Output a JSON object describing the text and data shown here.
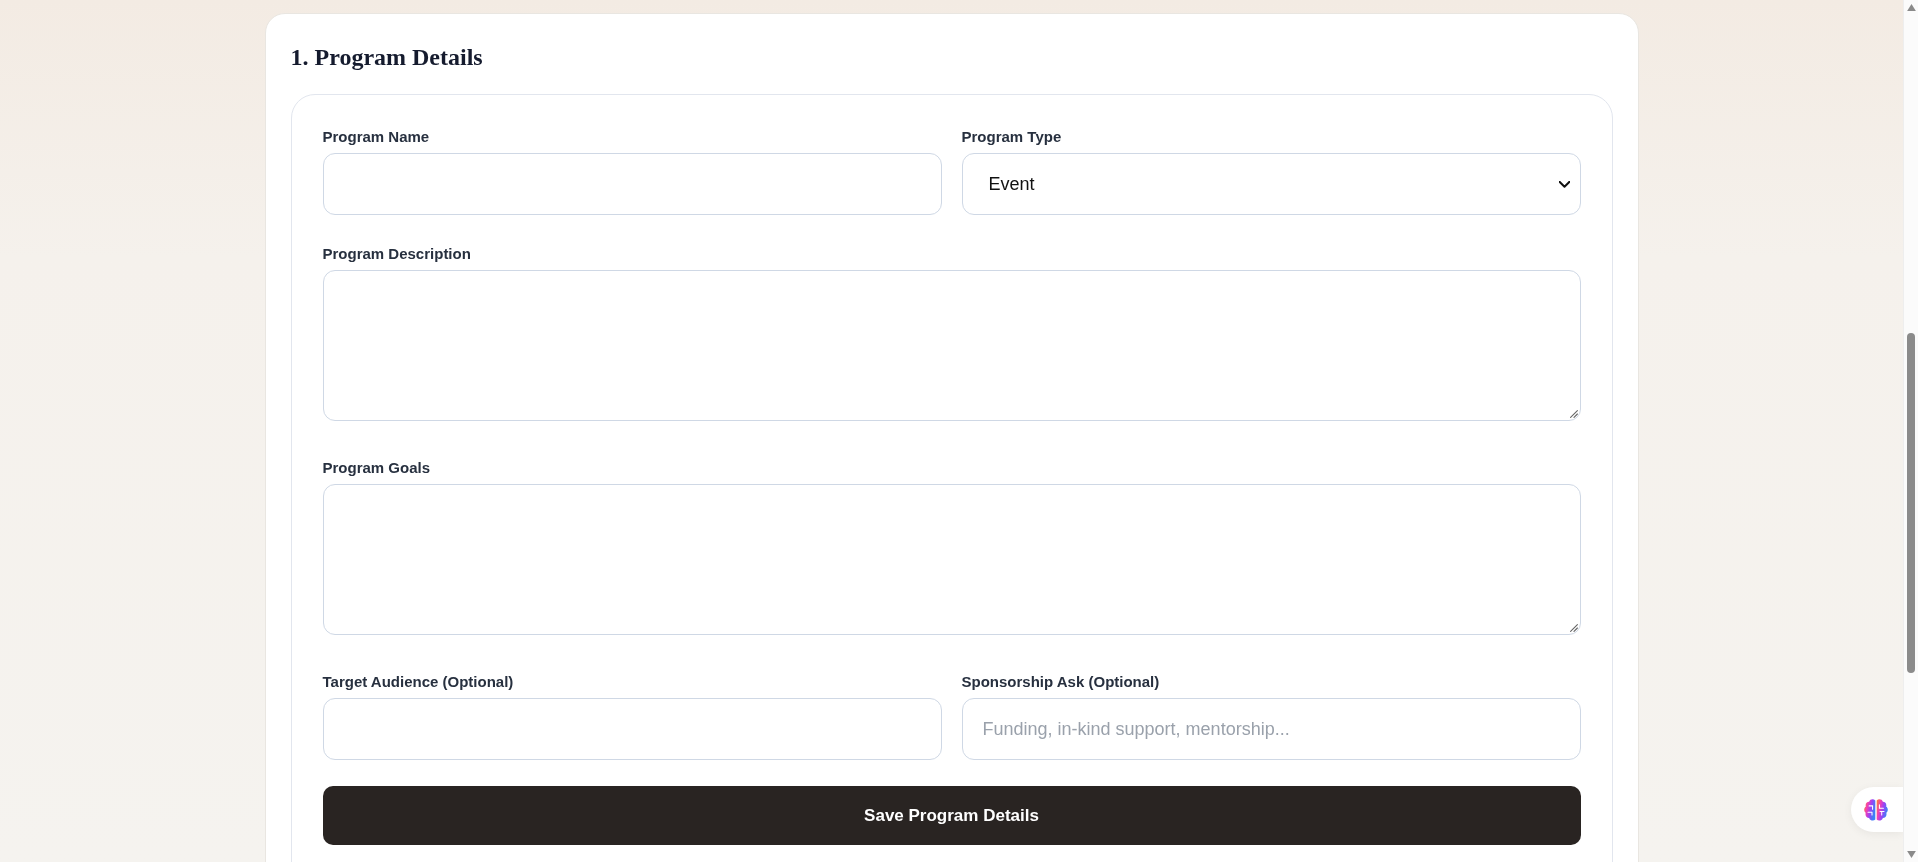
{
  "section": {
    "title": "1. Program Details"
  },
  "form": {
    "fields": [
      {
        "kind": "text",
        "label": "Program Name"
      },
      {
        "kind": "select",
        "label": "Program Type",
        "value": "Event"
      },
      {
        "kind": "textarea",
        "label": "Program Description"
      },
      {
        "kind": "textarea",
        "label": "Program Goals"
      },
      {
        "kind": "text",
        "label": "Target Audience (Optional)"
      },
      {
        "kind": "text",
        "label": "Sponsorship Ask (Optional)",
        "placeholder": "Funding, in-kind support, mentorship..."
      }
    ],
    "submit": {
      "label": "Save Program Details"
    }
  }
}
